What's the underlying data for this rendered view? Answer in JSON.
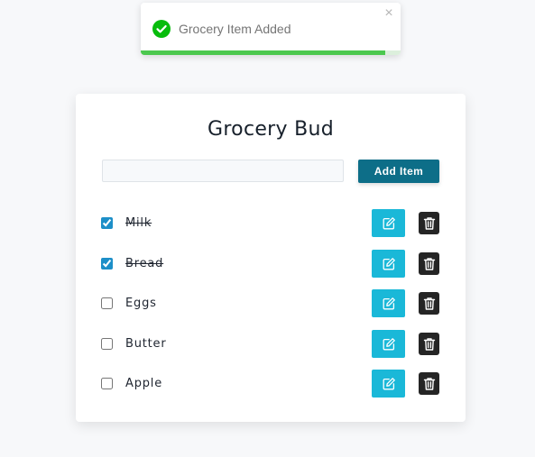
{
  "toast": {
    "message": "Grocery Item Added",
    "close_glyph": "×",
    "icon": "check-circle-icon",
    "progress_remaining": 0.94,
    "colors": {
      "success": "#07bc0c",
      "progress": "#4cc84f"
    }
  },
  "app": {
    "title": "Grocery Bud",
    "input": {
      "value": "",
      "placeholder": ""
    },
    "add_button_label": "Add Item",
    "items": [
      {
        "name": "Milk",
        "checked": true
      },
      {
        "name": "Bread",
        "checked": true
      },
      {
        "name": "Eggs",
        "checked": false
      },
      {
        "name": "Butter",
        "checked": false
      },
      {
        "name": "Apple",
        "checked": false
      }
    ],
    "icons": {
      "edit": "edit-icon",
      "delete": "trash-icon"
    },
    "colors": {
      "add_button": "#0d6e88",
      "edit_button": "#1ab8d8",
      "delete_button": "#252525"
    }
  }
}
